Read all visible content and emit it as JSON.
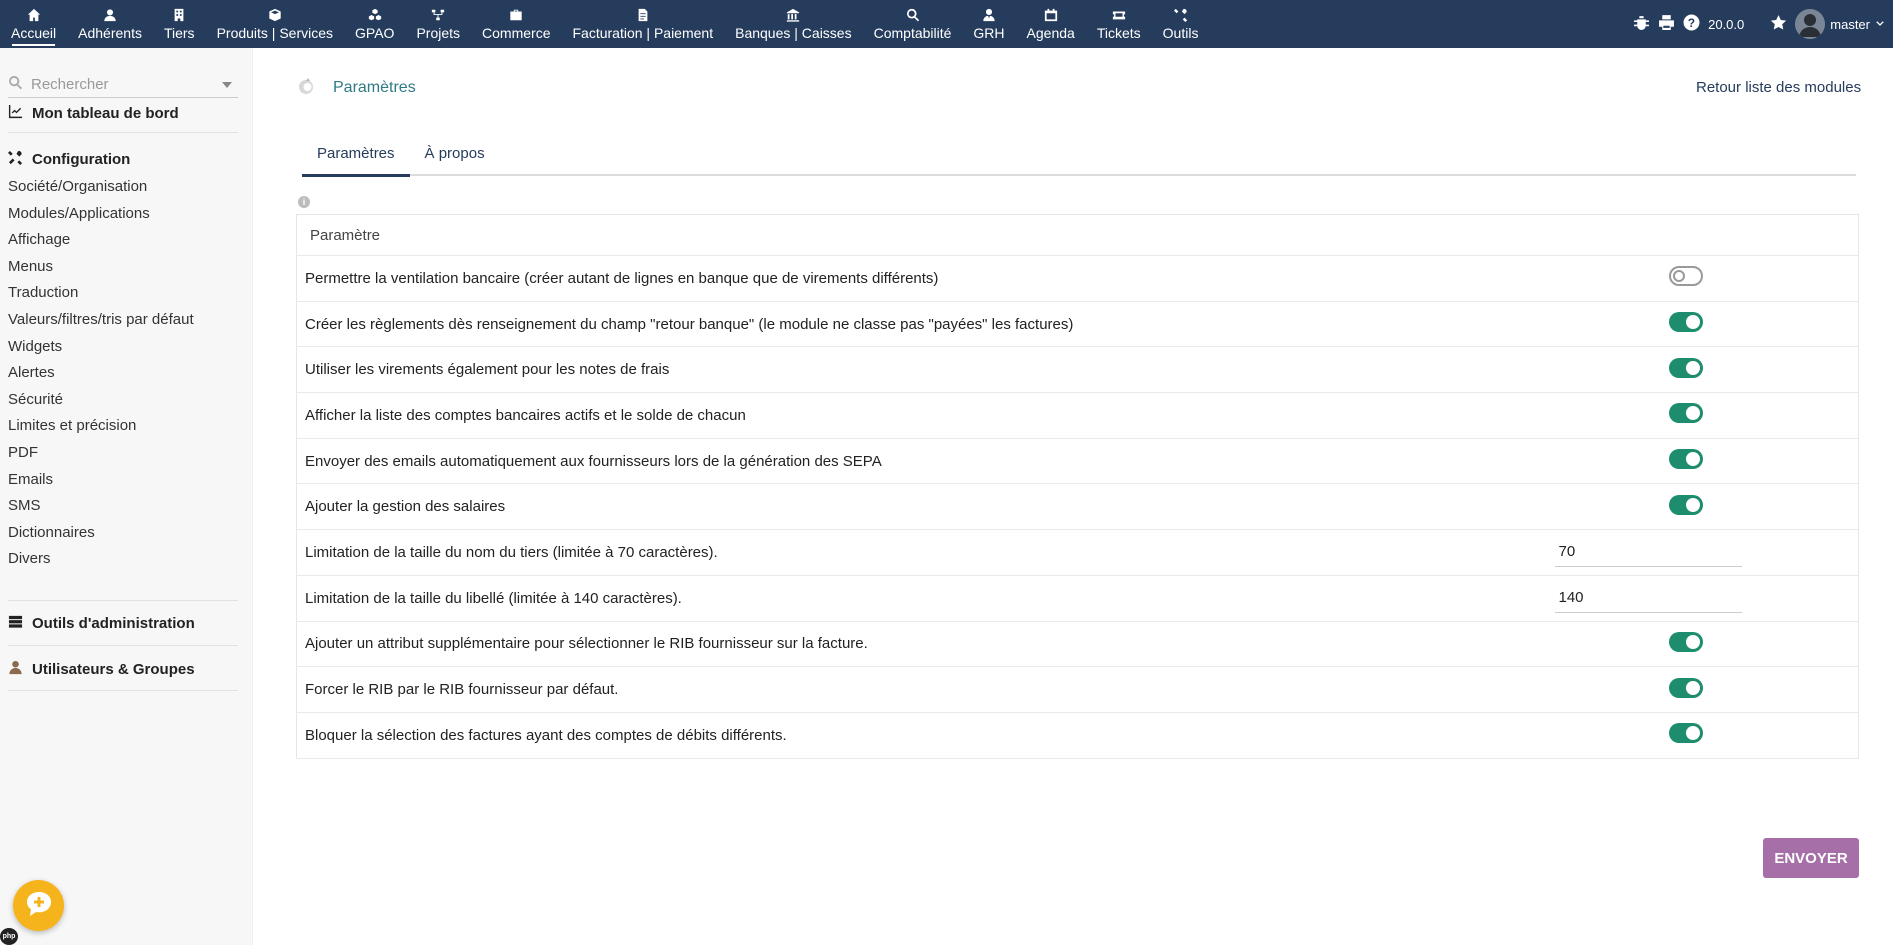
{
  "topnav": {
    "items": [
      {
        "label": "Accueil",
        "icon": "home-icon"
      },
      {
        "label": "Adhérents",
        "icon": "user-icon"
      },
      {
        "label": "Tiers",
        "icon": "building-icon"
      },
      {
        "label": "Produits | Services",
        "icon": "cube-icon"
      },
      {
        "label": "GPAO",
        "icon": "cubes-icon"
      },
      {
        "label": "Projets",
        "icon": "sitemap-icon"
      },
      {
        "label": "Commerce",
        "icon": "briefcase-icon"
      },
      {
        "label": "Facturation | Paiement",
        "icon": "invoice-icon"
      },
      {
        "label": "Banques | Caisses",
        "icon": "bank-icon"
      },
      {
        "label": "Comptabilité",
        "icon": "search-dollar-icon"
      },
      {
        "label": "GRH",
        "icon": "user-tie-icon"
      },
      {
        "label": "Agenda",
        "icon": "calendar-icon"
      },
      {
        "label": "Tickets",
        "icon": "ticket-icon"
      },
      {
        "label": "Outils",
        "icon": "tools-icon"
      }
    ],
    "version": "20.0.0",
    "user": "master"
  },
  "sidebar": {
    "search_placeholder": "Rechercher",
    "dashboard": "Mon tableau de bord",
    "configuration": "Configuration",
    "config_links": [
      "Société/Organisation",
      "Modules/Applications",
      "Affichage",
      "Menus",
      "Traduction",
      "Valeurs/filtres/tris par défaut",
      "Widgets",
      "Alertes",
      "Sécurité",
      "Limites et précision",
      "PDF",
      "Emails",
      "SMS",
      "Dictionnaires",
      "Divers"
    ],
    "admin_tools": "Outils d'administration",
    "users_groups": "Utilisateurs & Groupes"
  },
  "main": {
    "title": "Paramètres",
    "back_link": "Retour liste des modules",
    "tabs": [
      {
        "label": "Paramètres",
        "active": true
      },
      {
        "label": "À propos",
        "active": false
      }
    ],
    "table_header": "Paramètre",
    "rows": [
      {
        "label": "Permettre la ventilation bancaire (créer autant de lignes en banque que de virements différents)",
        "type": "toggle",
        "on": false
      },
      {
        "label": "Créer les règlements dès renseignement du champ \"retour banque\" (le module ne classe pas \"payées\" les factures)",
        "type": "toggle",
        "on": true
      },
      {
        "label": "Utiliser les virements également pour les notes de frais",
        "type": "toggle",
        "on": true
      },
      {
        "label": "Afficher la liste des comptes bancaires actifs et le solde de chacun",
        "type": "toggle",
        "on": true
      },
      {
        "label": "Envoyer des emails automatiquement aux fournisseurs lors de la génération des SEPA",
        "type": "toggle",
        "on": true
      },
      {
        "label": "Ajouter la gestion des salaires",
        "type": "toggle",
        "on": true
      },
      {
        "label": "Limitation de la taille du nom du tiers (limitée à 70 caractères).",
        "type": "input",
        "value": "70"
      },
      {
        "label": "Limitation de la taille du libellé (limitée à 140 caractères).",
        "type": "input",
        "value": "140"
      },
      {
        "label": "Ajouter un attribut supplémentaire pour sélectionner le RIB fournisseur sur la facture.",
        "type": "toggle",
        "on": true
      },
      {
        "label": "Forcer le RIB par le RIB fournisseur par défaut.",
        "type": "toggle",
        "on": true
      },
      {
        "label": "Bloquer la sélection des factures ayant des comptes de débits différents.",
        "type": "toggle",
        "on": true
      }
    ],
    "submit_label": "ENVOYER"
  },
  "colors": {
    "topbar": "#263c5c",
    "toggle_on": "#1e8d6d",
    "submit": "#a66fa8",
    "title": "#2f7a86",
    "chat": "#f5b41b"
  }
}
